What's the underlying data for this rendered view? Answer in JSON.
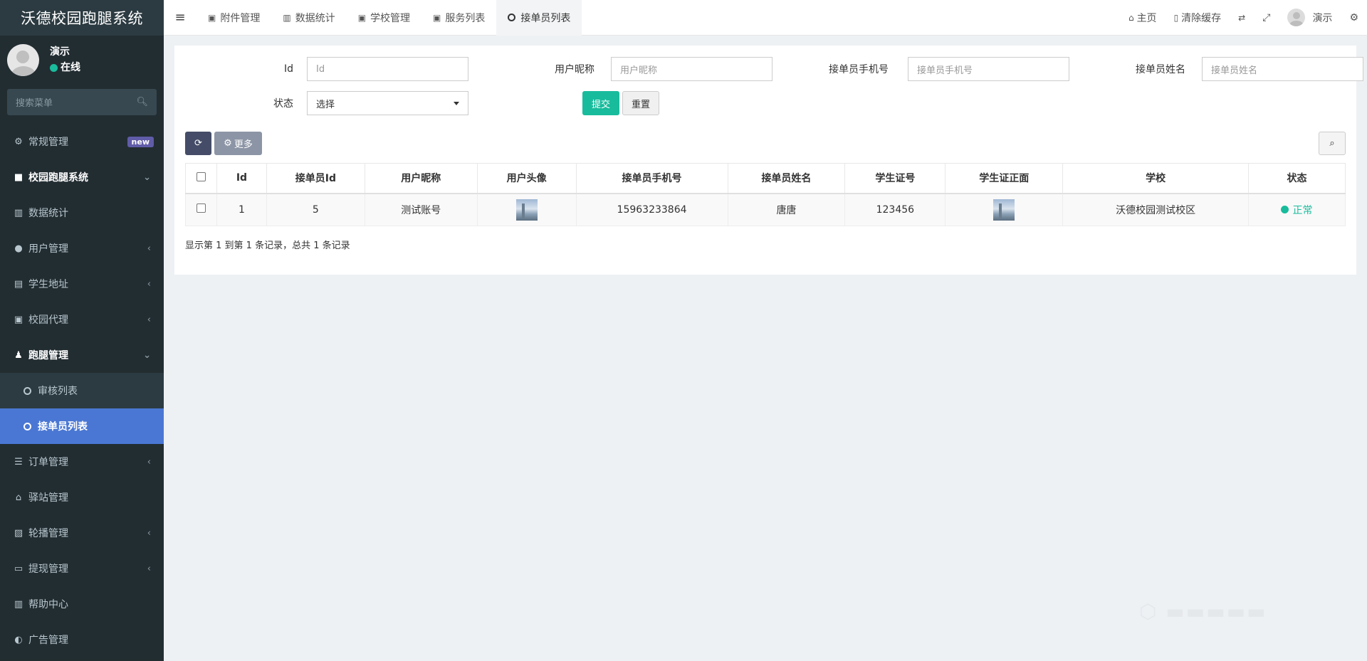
{
  "app": {
    "title": "沃德校园跑腿系统"
  },
  "user": {
    "name": "演示",
    "status": "在线"
  },
  "sidebar": {
    "search_placeholder": "搜索菜单",
    "items": [
      {
        "label": "常规管理",
        "badge": "new"
      },
      {
        "label": "校园跑腿系统"
      },
      {
        "label": "数据统计"
      },
      {
        "label": "用户管理"
      },
      {
        "label": "学生地址"
      },
      {
        "label": "校园代理"
      },
      {
        "label": "跑腿管理"
      },
      {
        "label": "审核列表"
      },
      {
        "label": "接单员列表"
      },
      {
        "label": "订单管理"
      },
      {
        "label": "驿站管理"
      },
      {
        "label": "轮播管理"
      },
      {
        "label": "提现管理"
      },
      {
        "label": "帮助中心"
      },
      {
        "label": "广告管理"
      }
    ]
  },
  "topbar": {
    "tabs": [
      "附件管理",
      "数据统计",
      "学校管理",
      "服务列表",
      "接单员列表"
    ],
    "home": "主页",
    "clear_cache": "清除缓存",
    "user_name": "演示"
  },
  "filters": {
    "id_label": "Id",
    "id_placeholder": "Id",
    "nickname_label": "用户昵称",
    "nickname_placeholder": "用户昵称",
    "phone_label": "接单员手机号",
    "phone_placeholder": "接单员手机号",
    "name_label": "接单员姓名",
    "name_placeholder": "接单员姓名",
    "status_label": "状态",
    "status_value": "选择",
    "submit": "提交",
    "reset": "重置"
  },
  "toolbar": {
    "more": "更多"
  },
  "table": {
    "headers": [
      "Id",
      "接单员Id",
      "用户昵称",
      "用户头像",
      "接单员手机号",
      "接单员姓名",
      "学生证号",
      "学生证正面",
      "学校",
      "状态"
    ],
    "rows": [
      {
        "id": "1",
        "runner_id": "5",
        "nickname": "测试账号",
        "phone": "15963233864",
        "name": "唐唐",
        "student_no": "123456",
        "school": "沃德校园测试校区",
        "status": "正常"
      }
    ]
  },
  "pagination": {
    "info": "显示第 1 到第 1 条记录，总共 1 条记录"
  },
  "colors": {
    "sidebar": "#222d32",
    "active": "#4a77d4",
    "success": "#18bc9c"
  }
}
